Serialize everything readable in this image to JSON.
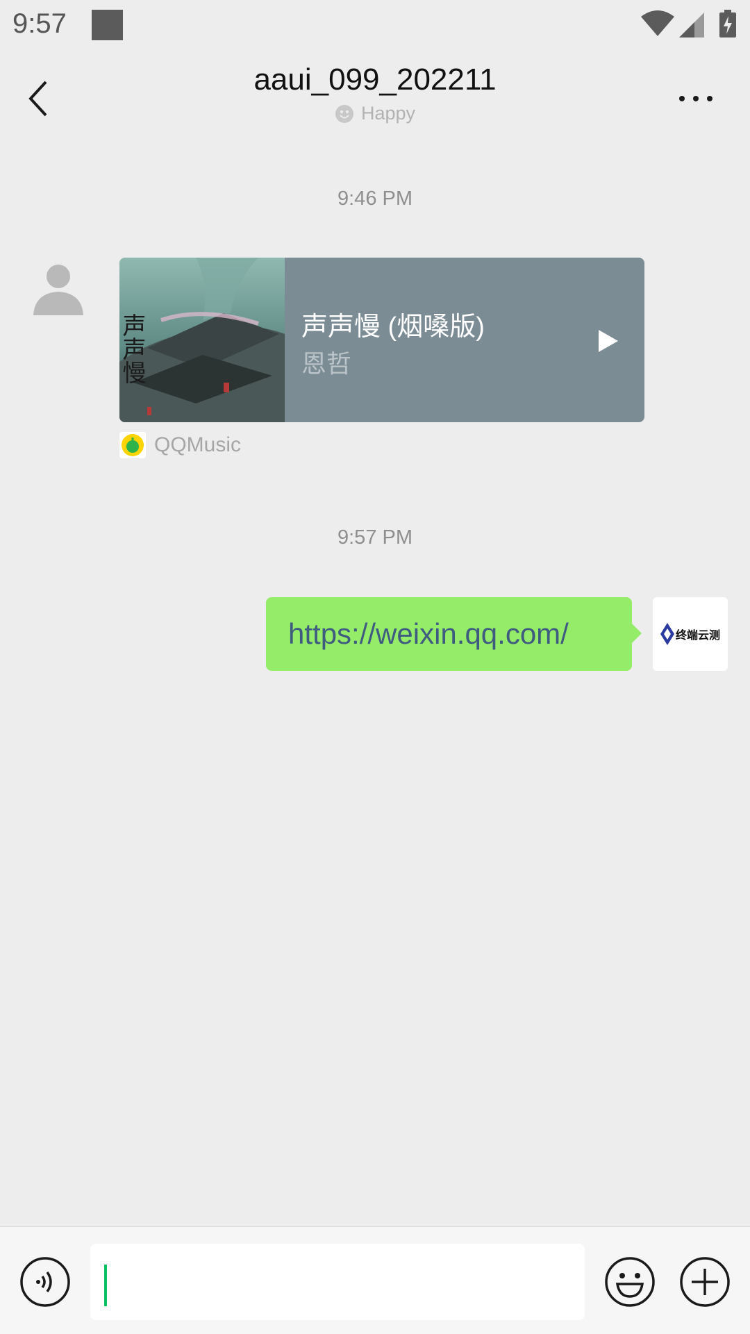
{
  "status_bar": {
    "time": "9:57"
  },
  "header": {
    "title": "aaui_099_202211",
    "status": "Happy"
  },
  "messages": [
    {
      "timestamp": "9:46 PM"
    },
    {
      "timestamp": "9:57 PM"
    }
  ],
  "music_card": {
    "title": "声声慢 (烟嗓版)",
    "artist": "恩哲",
    "source": "QQMusic",
    "album_art_text": "声声慢"
  },
  "sent_message": {
    "text": "https://weixin.qq.com/"
  },
  "avatar_right": {
    "logo_text": "终端云测"
  },
  "input": {
    "value": ""
  },
  "colors": {
    "bubble": "#95ec69",
    "card": "#7b8c94",
    "caret": "#07c160"
  }
}
